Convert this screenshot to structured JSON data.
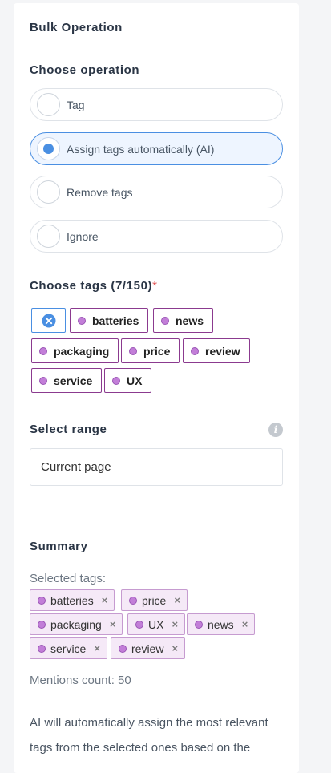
{
  "panel": {
    "title": "Bulk Operation",
    "operation": {
      "heading": "Choose operation",
      "options": [
        {
          "label": "Tag",
          "selected": false
        },
        {
          "label": "Assign tags automatically (AI)",
          "selected": true
        },
        {
          "label": "Remove tags",
          "selected": false
        },
        {
          "label": "Ignore",
          "selected": false
        }
      ]
    },
    "tags": {
      "heading": "Choose tags (7/150)",
      "required_mark": "*",
      "items": [
        "batteries",
        "news",
        "packaging",
        "price",
        "review",
        "service",
        "UX"
      ]
    },
    "range": {
      "heading": "Select range",
      "value": "Current page"
    },
    "summary": {
      "heading": "Summary",
      "selected_label": "Selected tags:",
      "chips": [
        "batteries",
        "price",
        "packaging",
        "UX",
        "news",
        "service",
        "review"
      ],
      "chip_remove": "×",
      "mentions": "Mentions count: 50",
      "description_line1": "AI will automatically assign the most relevant",
      "description_line2": "tags from the selected ones based on the"
    },
    "icons": {
      "info": "i"
    }
  }
}
